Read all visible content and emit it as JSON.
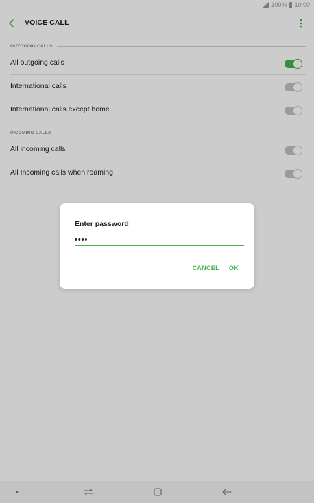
{
  "status_bar": {
    "battery_text": "100%",
    "time": "10:00"
  },
  "header": {
    "title": "VOICE CALL"
  },
  "sections": {
    "outgoing": {
      "label": "OUTGOING CALLS",
      "items": [
        {
          "label": "All outgoing calls",
          "enabled": true
        },
        {
          "label": "International calls",
          "enabled": false
        },
        {
          "label": "International calls except home",
          "enabled": false
        }
      ]
    },
    "incoming": {
      "label": "INCOMING CALLS",
      "items": [
        {
          "label": "All incoming calls",
          "enabled": false
        },
        {
          "label": "All Incoming calls when roaming",
          "enabled": false
        }
      ]
    }
  },
  "dialog": {
    "title": "Enter password",
    "password_value": "1234",
    "cancel_label": "CANCEL",
    "ok_label": "OK"
  },
  "nav_bar": {
    "icons": [
      "dot-icon",
      "recent-apps-icon",
      "home-icon",
      "back-icon"
    ]
  },
  "colors": {
    "accent": "#4caf50",
    "toggle_off": "#c2c2c2",
    "overlay": "rgba(0,0,0,0.2)"
  }
}
